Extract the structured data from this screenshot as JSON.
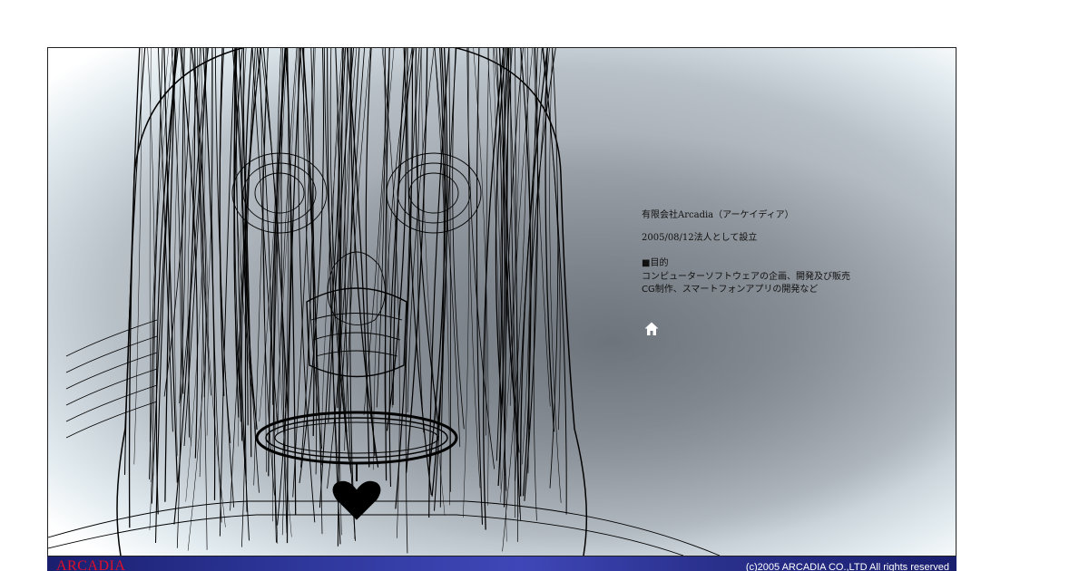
{
  "company": {
    "name": "有限会社Arcadia（アーケイディア）",
    "founded": "2005/08/12法人として設立",
    "purpose_heading": "■目的",
    "purpose_lines": [
      "コンピューターソフトウェアの企画、開発及び販売",
      "CG制作、スマートフォンアプリの開発など"
    ]
  },
  "nav": {
    "home_icon": "home-icon"
  },
  "footer": {
    "brand": "ARCADIA",
    "copyright": "(c)2005 ARCADIA CO.,LTD All rights reserved",
    "brand_color": "#e0102a",
    "bar_color": "#2c3597"
  }
}
